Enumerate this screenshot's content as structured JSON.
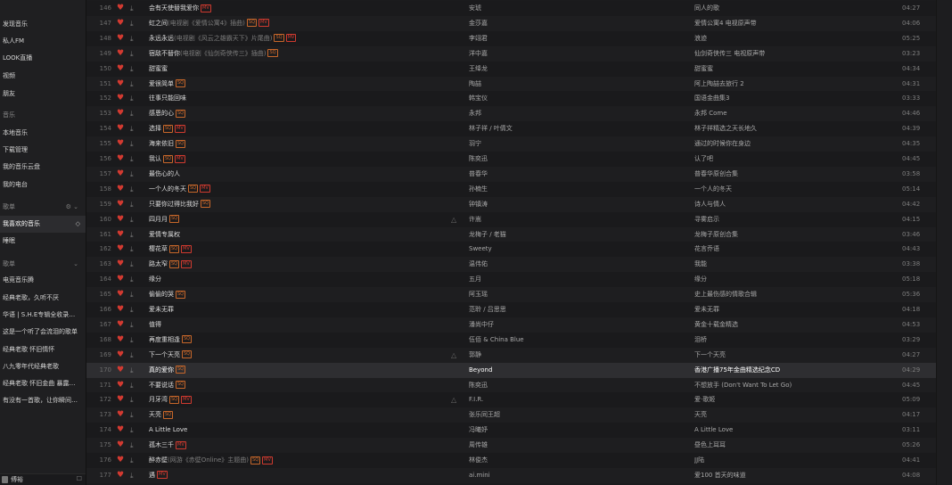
{
  "sidebar": {
    "items": [
      {
        "label": "发现音乐",
        "type": "item"
      },
      {
        "label": "私人FM",
        "type": "item"
      },
      {
        "label": "LOOK直播",
        "type": "item"
      },
      {
        "label": "视频",
        "type": "item"
      },
      {
        "label": "朋友",
        "type": "item"
      },
      {
        "label": "音乐",
        "type": "header"
      },
      {
        "label": "本地音乐",
        "type": "item"
      },
      {
        "label": "下载管理",
        "type": "item"
      },
      {
        "label": "我的音乐云盘",
        "type": "item"
      },
      {
        "label": "我的电台",
        "type": "item"
      },
      {
        "label": "歌单",
        "type": "header-created"
      },
      {
        "label": "我喜欢的音乐",
        "type": "selected"
      },
      {
        "label": "睡眠",
        "type": "item"
      },
      {
        "label": "歌单",
        "type": "header-collected"
      },
      {
        "label": "电竞音乐腾",
        "type": "item"
      },
      {
        "label": "经典老歌，久听不厌",
        "type": "item"
      },
      {
        "label": "华语 | S.H.E专辑全收录…",
        "type": "item"
      },
      {
        "label": "这是一个听了会流泪的歌单",
        "type": "item"
      },
      {
        "label": "经典老歌 怀旧情怀",
        "type": "item"
      },
      {
        "label": "八九零年代经典老歌",
        "type": "item"
      },
      {
        "label": "经典老歌 怀旧金曲 暴露…",
        "type": "item"
      },
      {
        "label": "有没有一首歌，让你瞬间…",
        "type": "item"
      }
    ],
    "bottom_user_name": "傅裕",
    "bottom_mail_icon": "☐",
    "settings_glyphs": "⚙ ⌄",
    "collapse_glyph": "⌄",
    "eye_glyph": "👁"
  },
  "icons": {
    "heart": "♥",
    "download": "⤓",
    "similar": "△"
  },
  "songs": [
    {
      "num": "146",
      "title": "会有天使替我爱你",
      "note": "",
      "badges": [
        "MV"
      ],
      "similar": false,
      "artist": "安琥",
      "album": "同人的歌",
      "time": "04:27"
    },
    {
      "num": "147",
      "title": "虹之间",
      "note": "(电视剧《爱情公寓4》插曲)",
      "badges": [
        "SQ",
        "MV"
      ],
      "similar": false,
      "artist": "金莎嘉",
      "album": "爱情公寓4 电视原声带",
      "time": "04:06"
    },
    {
      "num": "148",
      "title": "永远永远",
      "note": "(电视剧《风云之雄霸天下》片尾曲)",
      "badges": [
        "SQ",
        "MV"
      ],
      "similar": false,
      "artist": "李翊君",
      "album": "浪迹",
      "time": "05:25"
    },
    {
      "num": "149",
      "title": "宿敌不替你",
      "note": "(电视剧《仙剑奇侠传三》插曲)",
      "badges": [
        "SQ"
      ],
      "similar": false,
      "artist": "洋中嘉",
      "album": "仙剑奇侠传三 电视原声带",
      "time": "03:23"
    },
    {
      "num": "150",
      "title": "甜蜜蜜",
      "note": "",
      "badges": [],
      "similar": false,
      "artist": "王绛龙",
      "album": "甜蜜蜜",
      "time": "04:34"
    },
    {
      "num": "151",
      "title": "爱很简单",
      "note": "",
      "badges": [
        "SQ"
      ],
      "similar": false,
      "artist": "陶喆",
      "album": "阿上陶喆去旅行 2",
      "time": "04:31"
    },
    {
      "num": "152",
      "title": "往事只能回味",
      "note": "",
      "badges": [],
      "similar": false,
      "artist": "韩宝仪",
      "album": "国语金曲集3",
      "time": "03:33"
    },
    {
      "num": "153",
      "title": "感恩的心",
      "note": "",
      "badges": [
        "SQ"
      ],
      "similar": false,
      "artist": "永邦",
      "album": "永邦 Come",
      "time": "04:46"
    },
    {
      "num": "154",
      "title": "选择",
      "note": "",
      "badges": [
        "SQ",
        "MV"
      ],
      "similar": false,
      "artist": "林子祥 / 叶倩文",
      "album": "林子祥精选之天长地久",
      "time": "04:39"
    },
    {
      "num": "155",
      "title": "海来依旧",
      "note": "",
      "badges": [
        "SQ"
      ],
      "similar": false,
      "artist": "羽宁",
      "album": "通过的时候你在身边",
      "time": "04:35"
    },
    {
      "num": "156",
      "title": "我认",
      "note": "",
      "badges": [
        "SQ",
        "MV"
      ],
      "similar": false,
      "artist": "陈奕迅",
      "album": "认了吧",
      "time": "04:45"
    },
    {
      "num": "157",
      "title": "最伤心的人",
      "note": "",
      "badges": [],
      "similar": false,
      "artist": "普春华",
      "album": "普春华原创合集",
      "time": "03:58"
    },
    {
      "num": "158",
      "title": "一个人的冬天",
      "note": "",
      "badges": [
        "SQ",
        "MV"
      ],
      "similar": false,
      "artist": "孙楠生",
      "album": "一个人的冬天",
      "time": "05:14"
    },
    {
      "num": "159",
      "title": "只要你过得比我好",
      "note": "",
      "badges": [
        "SQ"
      ],
      "similar": false,
      "artist": "钟镇涛",
      "album": "诗人与情人",
      "time": "04:42"
    },
    {
      "num": "160",
      "title": "四月月",
      "note": "",
      "badges": [
        "SQ"
      ],
      "similar": true,
      "artist": "许嵩",
      "album": "寻雾启示",
      "time": "04:15"
    },
    {
      "num": "161",
      "title": "爱情专属权",
      "note": "",
      "badges": [],
      "similar": false,
      "artist": "龙梅子 / 老猫",
      "album": "龙梅子原创合集",
      "time": "03:46"
    },
    {
      "num": "162",
      "title": "樱花草",
      "note": "",
      "badges": [
        "SQ",
        "MV"
      ],
      "similar": false,
      "artist": "Sweety",
      "album": "花言乔语",
      "time": "04:43"
    },
    {
      "num": "163",
      "title": "路太窄",
      "note": "",
      "badges": [
        "SQ",
        "MV"
      ],
      "similar": false,
      "artist": "温伟佑",
      "album": "我能",
      "time": "03:38"
    },
    {
      "num": "164",
      "title": "缘分",
      "note": "",
      "badges": [],
      "similar": false,
      "artist": "五月",
      "album": "缘分",
      "time": "05:18"
    },
    {
      "num": "165",
      "title": "偷偷的哭",
      "note": "",
      "badges": [
        "SQ"
      ],
      "similar": false,
      "artist": "阿玉瑶",
      "album": "史上最伤感的情歌合辑",
      "time": "05:36"
    },
    {
      "num": "166",
      "title": "爱未无罪",
      "note": "",
      "badges": [],
      "similar": false,
      "artist": "范聆 / 吕思思",
      "album": "爱未无罪",
      "time": "04:18"
    },
    {
      "num": "167",
      "title": "值得",
      "note": "",
      "badges": [],
      "similar": false,
      "artist": "潘尚中仔",
      "album": "黄金十载金精选",
      "time": "04:53"
    },
    {
      "num": "168",
      "title": "再度重相逢",
      "note": "",
      "badges": [
        "SQ"
      ],
      "similar": false,
      "artist": "伍佰 & China Blue",
      "album": "泪桥",
      "time": "03:29"
    },
    {
      "num": "169",
      "title": "下一个天亮",
      "note": "",
      "badges": [
        "SQ"
      ],
      "similar": true,
      "artist": "郭静",
      "album": "下一个天亮",
      "time": "04:27"
    },
    {
      "num": "170",
      "title": "真的爱你",
      "note": "",
      "badges": [
        "SQ"
      ],
      "similar": false,
      "artist": "Beyond",
      "album": "香港广播75年金曲精选纪念CD",
      "time": "04:29",
      "playing": true
    },
    {
      "num": "171",
      "title": "不要说话",
      "note": "",
      "badges": [
        "SQ"
      ],
      "similar": false,
      "artist": "陈奕迅",
      "album": "不想放手 (Don't Want To Let Go)",
      "time": "04:45"
    },
    {
      "num": "172",
      "title": "月牙湾",
      "note": "",
      "badges": [
        "SQ",
        "MV"
      ],
      "similar": true,
      "artist": "F.I.R.",
      "album": "爱·歌姬",
      "time": "05:09"
    },
    {
      "num": "173",
      "title": "天亮",
      "note": "",
      "badges": [
        "SQ"
      ],
      "similar": false,
      "artist": "张乐同王超",
      "album": "天亮",
      "time": "04:17"
    },
    {
      "num": "174",
      "title": "A Little Love",
      "note": "",
      "badges": [],
      "similar": false,
      "artist": "冯曦妤",
      "album": "A Little Love",
      "time": "03:11"
    },
    {
      "num": "175",
      "title": "孤木三千",
      "note": "",
      "badges": [
        "MV"
      ],
      "similar": false,
      "artist": "周传雄",
      "album": "昼色上耳耳",
      "time": "05:26"
    },
    {
      "num": "176",
      "title": "醉赤壁",
      "note": "(网游《赤壁Online》主题曲)",
      "badges": [
        "SQ",
        "MV"
      ],
      "similar": false,
      "artist": "林俊杰",
      "album": "JJ陆",
      "time": "04:41"
    },
    {
      "num": "177",
      "title": "遇",
      "note": "",
      "badges": [
        "MV"
      ],
      "similar": false,
      "artist": "ai.mini",
      "album": "爱100 首天的味道",
      "time": "04:08"
    }
  ]
}
